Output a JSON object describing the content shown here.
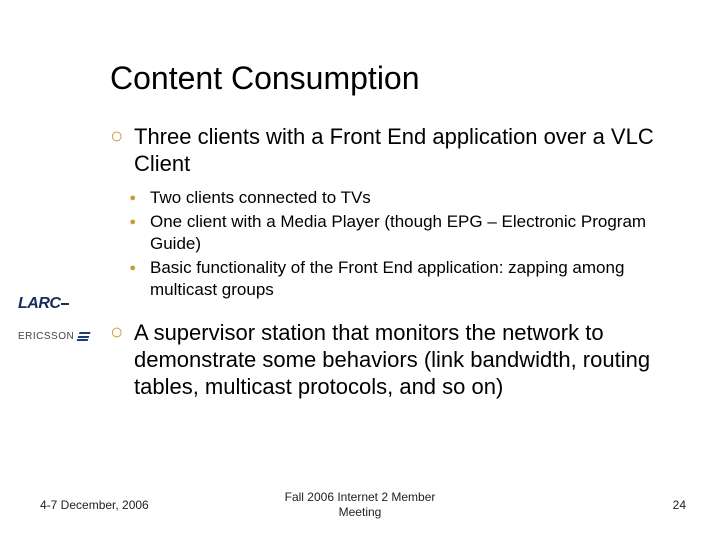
{
  "slide": {
    "title": "Content Consumption",
    "bullets": [
      {
        "text": "Three clients with a Front End application over a VLC Client",
        "sub": [
          "Two clients connected to TVs",
          "One client with a Media Player (though EPG – Electronic Program Guide)",
          "Basic functionality of the Front End application: zapping among multicast groups"
        ]
      },
      {
        "text": "A supervisor station that monitors the network to demonstrate some behaviors (link bandwidth, routing tables, multicast protocols, and so on)",
        "sub": []
      }
    ]
  },
  "logos": {
    "larc": "LARC",
    "ericsson": "ERICSSON"
  },
  "footer": {
    "date": "4-7 December, 2006",
    "center_line1": "Fall 2006 Internet 2 Member",
    "center_line2": "Meeting",
    "page": "24"
  }
}
